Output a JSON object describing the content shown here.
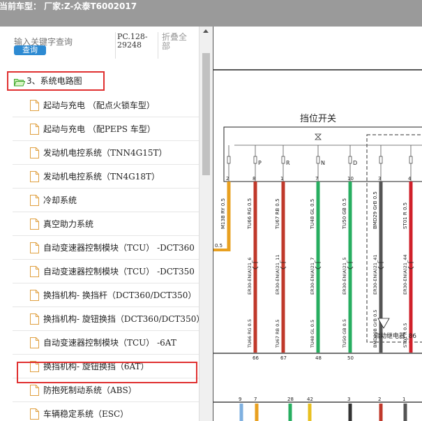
{
  "header": {
    "model_text": "当前车型： 厂家:Z-众泰T6002017"
  },
  "search": {
    "placeholder": "输入关键字查询",
    "button_label": "查询",
    "doc_code": "PC.128-29248",
    "collapse_label": "折叠全部"
  },
  "tree": {
    "root": {
      "label": "3、系统电路图"
    },
    "items": [
      {
        "label": "起动与充电 （配点火锁车型）"
      },
      {
        "label": "起动与充电 （配PEPS 车型）"
      },
      {
        "label": "发动机电控系统（TNN4G15T）"
      },
      {
        "label": "发动机电控系统（TN4G18T）"
      },
      {
        "label": "冷却系统"
      },
      {
        "label": "真空助力系统"
      },
      {
        "label": "自动变速器控制模块（TCU） -DCT360"
      },
      {
        "label": "自动变速器控制模块（TCU） -DCT350"
      },
      {
        "label": "换挡机构- 换挡杆（DCT360/DCT350）"
      },
      {
        "label": "换挡机构- 旋钮换挡（DCT360/DCT350）"
      },
      {
        "label": "自动变速器控制模块（TCU） -6AT"
      },
      {
        "label": "换挡机构- 旋钮换挡（6AT）"
      },
      {
        "label": "防抱死制动系统（ABS）"
      },
      {
        "label": "车辆稳定系统（ESC）"
      }
    ],
    "selected_index": 10
  },
  "diagram": {
    "title": "挡位开关",
    "pins_top": [
      "2",
      "8",
      "1",
      "7",
      "10",
      "3",
      "4"
    ],
    "switch_letters": [
      "P",
      "R",
      "N",
      "D"
    ],
    "wires": [
      {
        "code": "M13B RY 0.5",
        "color": "#e8a020"
      },
      {
        "code": "TU66 RG 0.5",
        "color": "#c0392b"
      },
      {
        "code": "TU67 RB 0.5",
        "color": "#c0392b"
      },
      {
        "code": "TU48 GL 0.5",
        "color": "#27ae60"
      },
      {
        "code": "TU50 GB 0.5",
        "color": "#27ae60"
      },
      {
        "code": "BMD29 GrB 0.5",
        "color": "#555555"
      },
      {
        "code": "ST01 R 0.5",
        "color": "#d0202a"
      }
    ],
    "connector_labels": [
      "ER30-EN(A)21_6",
      "ER30-EN(A)21_11",
      "ER30-EN(A)21_7",
      "ER30-EN(A)21_5",
      "ER30-EN(A)21_41",
      "ER30-EN(A)21_44"
    ],
    "lower_wires": [
      "TU66 RG 0.5",
      "TU67 RB 0.5",
      "TU48 GL 0.5",
      "TU50 GB 0.5",
      "BMD29B GrB 0.5",
      "ST01 R 0.5"
    ],
    "bottom_pins": [
      "66",
      "67",
      "48",
      "50"
    ],
    "relay_label": "启动继电器_86",
    "pin_row_2": [
      "9",
      "7",
      "28",
      "42",
      "3",
      "2",
      "1"
    ],
    "side_value": "0.5"
  }
}
